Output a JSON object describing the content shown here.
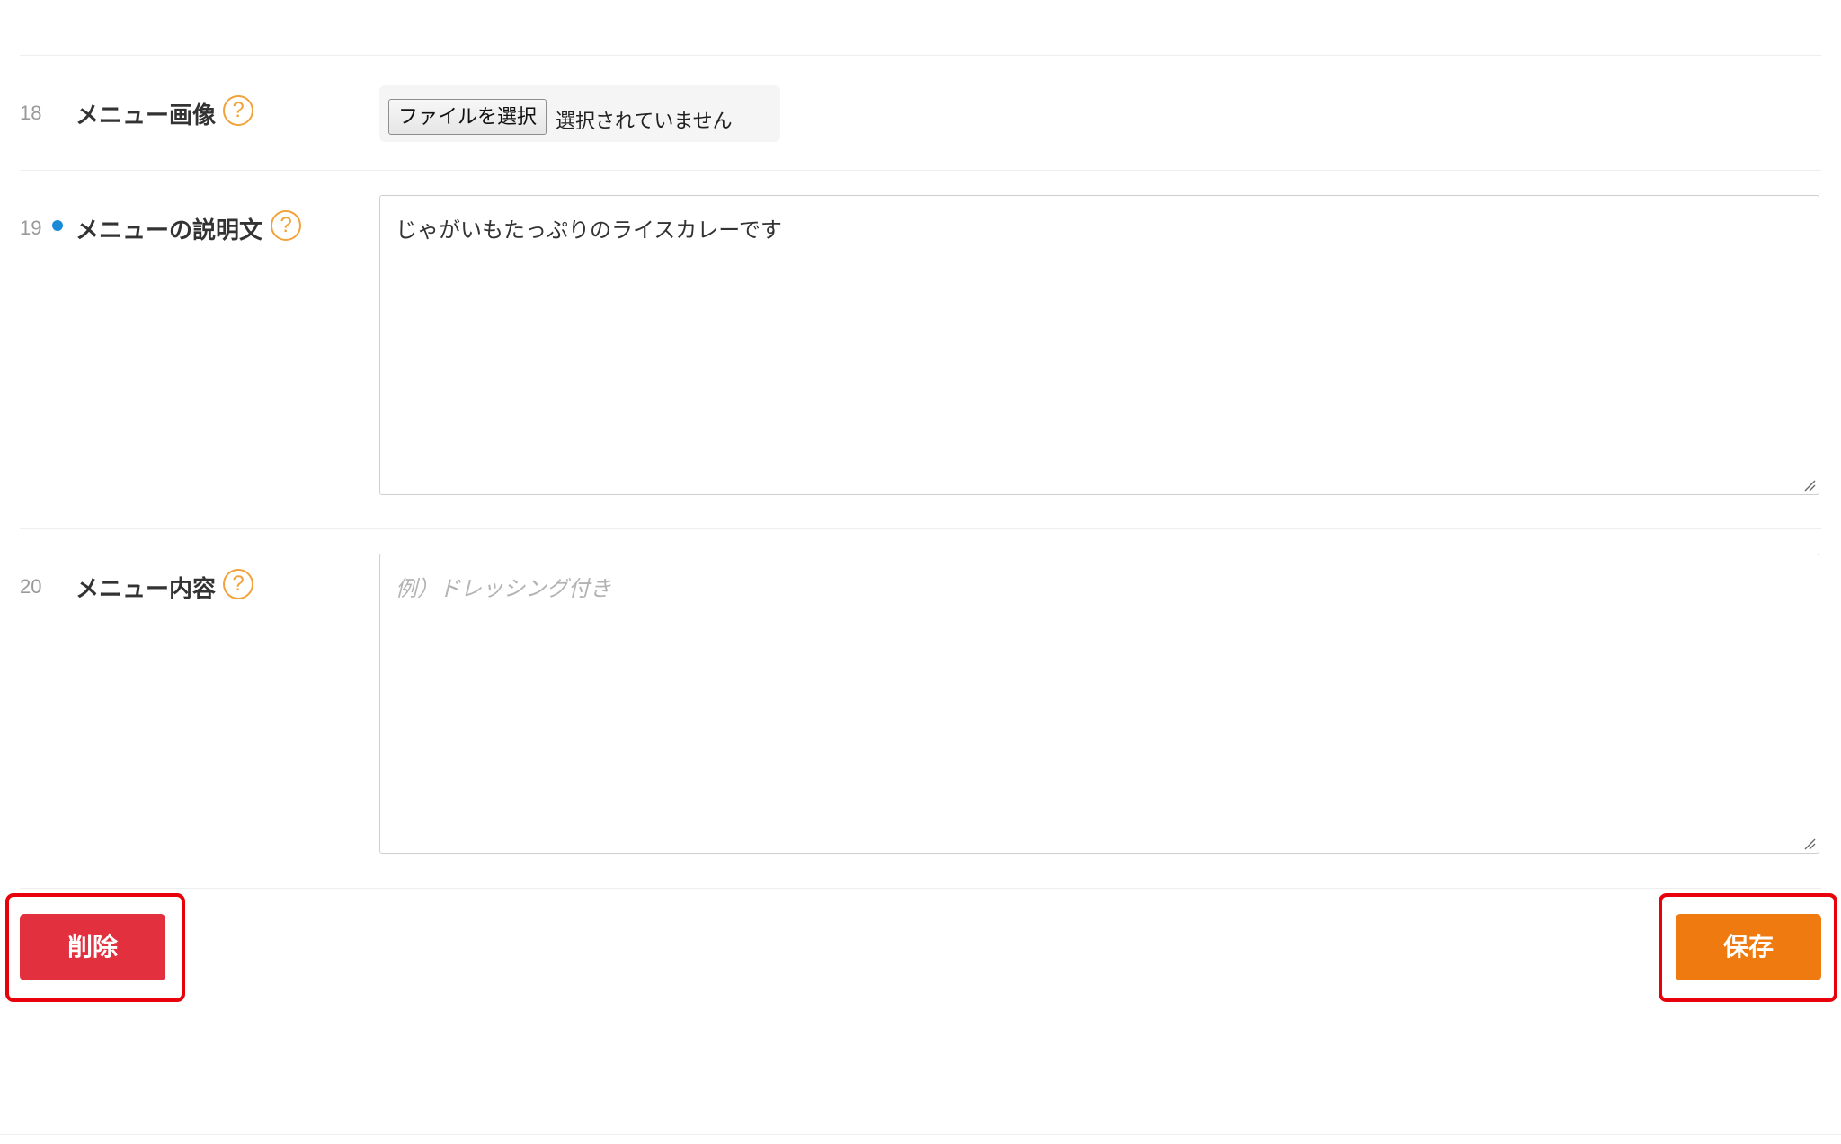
{
  "rows": [
    {
      "number": "18",
      "label": "メニュー画像",
      "help_icon": "question-circle-icon",
      "file_input": {
        "button_label": "ファイルを選択",
        "status": "選択されていません"
      }
    },
    {
      "number": "19",
      "required": true,
      "label": "メニューの説明文",
      "help_icon": "question-circle-icon",
      "value": "じゃがいもたっぷりのライスカレーです"
    },
    {
      "number": "20",
      "label": "メニュー内容",
      "help_icon": "question-circle-icon",
      "placeholder": "例）ドレッシング付き"
    }
  ],
  "actions": {
    "delete_label": "削除",
    "save_label": "保存"
  },
  "colors": {
    "required_dot": "#1a8ad6",
    "help_icon": "#f2a23a",
    "delete_button": "#e2303f",
    "save_button": "#ee7a10",
    "highlight_border": "#e8000b"
  }
}
